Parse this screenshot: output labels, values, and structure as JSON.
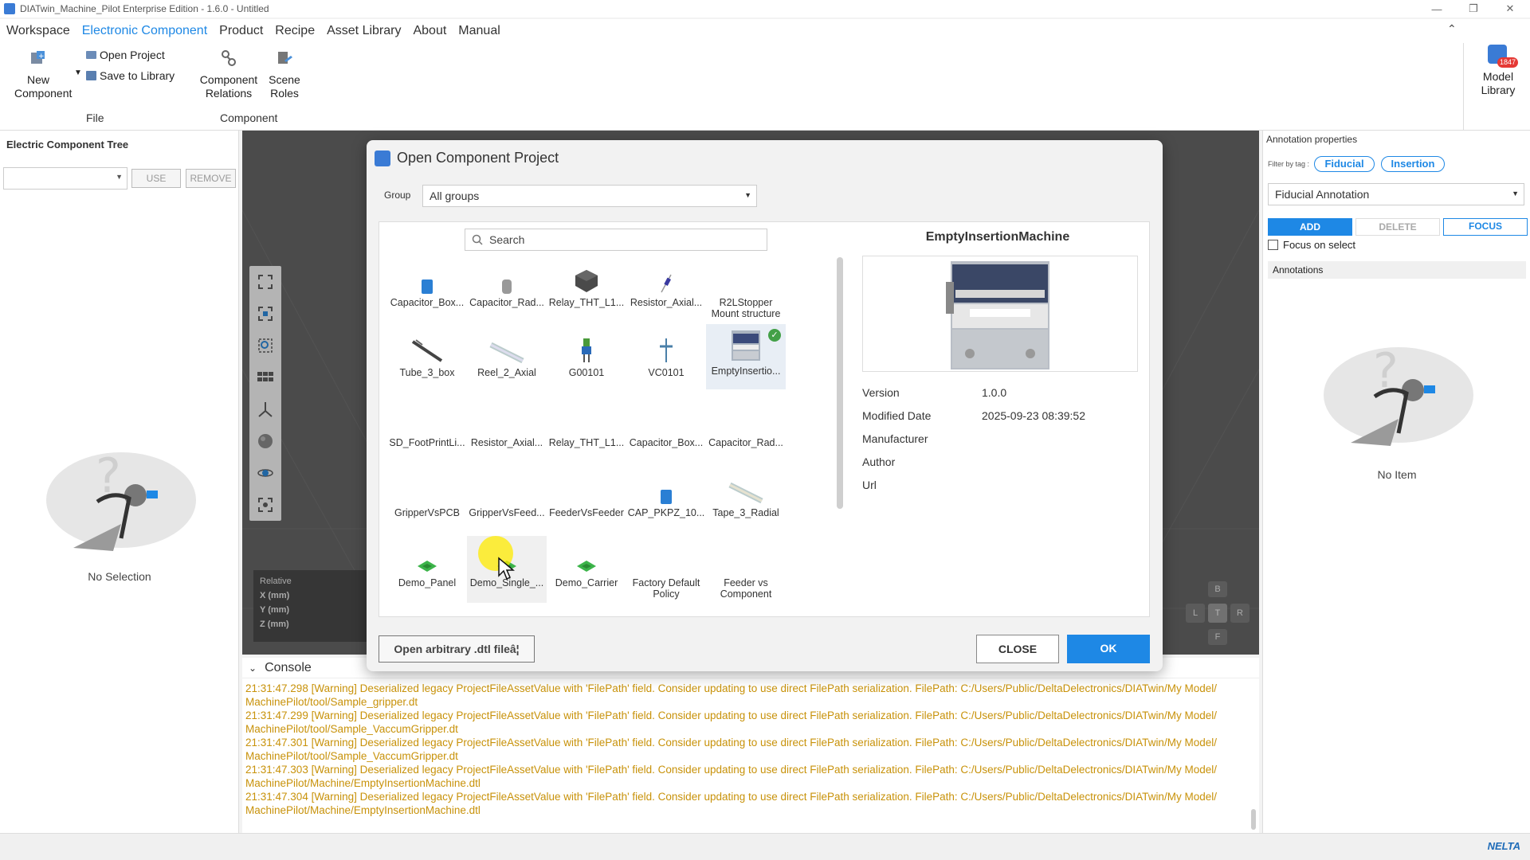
{
  "window": {
    "title": "DIATwin_Machine_Pilot Enterprise Edition - 1.6.0 - Untitled"
  },
  "menu": {
    "items": [
      "Workspace",
      "Electronic Component",
      "Product",
      "Recipe",
      "Asset Library",
      "About",
      "Manual"
    ]
  },
  "ribbon": {
    "new_component": "New Component",
    "open_project": "Open Project",
    "save_to_library": "Save to Library",
    "component_relations": "Component Relations",
    "scene_roles": "Scene Roles",
    "group_file": "File",
    "group_component": "Component",
    "model_library": "Model Library",
    "model_library_badge": "1847"
  },
  "left_panel": {
    "title": "Electric Component Tree",
    "use": "USE",
    "remove": "REMOVE",
    "empty": "No Selection"
  },
  "coords": {
    "mode": "Relative",
    "x": "X (mm)",
    "y": "Y (mm)",
    "z": "Z (mm)"
  },
  "navcube": {
    "b": "B",
    "l": "L",
    "t": "T",
    "r": "R",
    "f": "F"
  },
  "right_panel": {
    "title": "Annotation properties",
    "filter_label": "Filter by tag :",
    "tag_fiducial": "Fiducial",
    "tag_insertion": "Insertion",
    "annotation_type": "Fiducial Annotation",
    "add": "ADD",
    "delete": "DELETE",
    "focus": "FOCUS",
    "focus_on_select": "Focus on select",
    "annotations": "Annotations",
    "empty": "No Item"
  },
  "console": {
    "title": "Console",
    "lines": [
      "21:31:47.298 [Warning] Deserialized legacy ProjectFileAssetValue with 'FilePath' field. Consider updating to use direct FilePath serialization. FilePath: C:/Users/Public/DeltaDelectronics/DIATwin/My Model/",
      "MachinePilot/tool/Sample_gripper.dt",
      "21:31:47.299 [Warning] Deserialized legacy ProjectFileAssetValue with 'FilePath' field. Consider updating to use direct FilePath serialization. FilePath: C:/Users/Public/DeltaDelectronics/DIATwin/My Model/",
      "MachinePilot/tool/Sample_VaccumGripper.dt",
      "21:31:47.301 [Warning] Deserialized legacy ProjectFileAssetValue with 'FilePath' field. Consider updating to use direct FilePath serialization. FilePath: C:/Users/Public/DeltaDelectronics/DIATwin/My Model/",
      "MachinePilot/tool/Sample_VaccumGripper.dt",
      "21:31:47.303 [Warning] Deserialized legacy ProjectFileAssetValue with 'FilePath' field. Consider updating to use direct FilePath serialization. FilePath: C:/Users/Public/DeltaDelectronics/DIATwin/My Model/",
      "MachinePilot/Machine/EmptyInsertionMachine.dtl",
      "21:31:47.304 [Warning] Deserialized legacy ProjectFileAssetValue with 'FilePath' field. Consider updating to use direct FilePath serialization. FilePath: C:/Users/Public/DeltaDelectronics/DIATwin/My Model/",
      "MachinePilot/Machine/EmptyInsertionMachine.dtl"
    ]
  },
  "status": {
    "brand": "NELTA"
  },
  "dialog": {
    "title": "Open Component Project",
    "group_label": "Group",
    "group_value": "All groups",
    "search_placeholder": "Search",
    "tiles": [
      {
        "label": "Capacitor_Box...",
        "icon": "capacitor-box-icon"
      },
      {
        "label": "Capacitor_Rad...",
        "icon": "capacitor-radial-icon"
      },
      {
        "label": "Relay_THT_L1...",
        "icon": "relay-icon"
      },
      {
        "label": "Resistor_Axial...",
        "icon": "resistor-icon"
      },
      {
        "label": "R2LStopper Mount structure",
        "icon": ""
      },
      {
        "label": "Tube_3_box",
        "icon": "tube-icon"
      },
      {
        "label": "Reel_2_Axial",
        "icon": "reel-icon"
      },
      {
        "label": "G00101",
        "icon": "gripper-icon"
      },
      {
        "label": "VC0101",
        "icon": "vacuum-icon"
      },
      {
        "label": "EmptyInsertio...",
        "icon": "machine-icon"
      },
      {
        "label": "SD_FootPrintLi...",
        "icon": ""
      },
      {
        "label": "Resistor_Axial...",
        "icon": ""
      },
      {
        "label": "Relay_THT_L1...",
        "icon": ""
      },
      {
        "label": "Capacitor_Box...",
        "icon": ""
      },
      {
        "label": "Capacitor_Rad...",
        "icon": ""
      },
      {
        "label": "GripperVsPCB",
        "icon": ""
      },
      {
        "label": "GripperVsFeed...",
        "icon": ""
      },
      {
        "label": "FeederVsFeeder",
        "icon": ""
      },
      {
        "label": "CAP_PKPZ_10...",
        "icon": "capacitor-box-icon"
      },
      {
        "label": "Tape_3_Radial",
        "icon": "tape-icon"
      },
      {
        "label": "Demo_Panel",
        "icon": "pcb-icon"
      },
      {
        "label": "Demo_Single_...",
        "icon": "pcb-icon"
      },
      {
        "label": "Demo_Carrier",
        "icon": "pcb-icon"
      },
      {
        "label": "Factory Default Policy",
        "icon": ""
      },
      {
        "label": "Feeder vs Component",
        "icon": ""
      }
    ],
    "detail": {
      "name": "EmptyInsertionMachine",
      "version_label": "Version",
      "version": "1.0.0",
      "modified_label": "Modified Date",
      "modified": "2025-09-23 08:39:52",
      "manufacturer_label": "Manufacturer",
      "author_label": "Author",
      "url_label": "Url"
    },
    "open_arbitrary": "Open arbitrary .dtl fileâ¦",
    "close": "CLOSE",
    "ok": "OK",
    "colors": {
      "accent": "#1e88e5",
      "ok_bg": "#1e88e5"
    }
  }
}
